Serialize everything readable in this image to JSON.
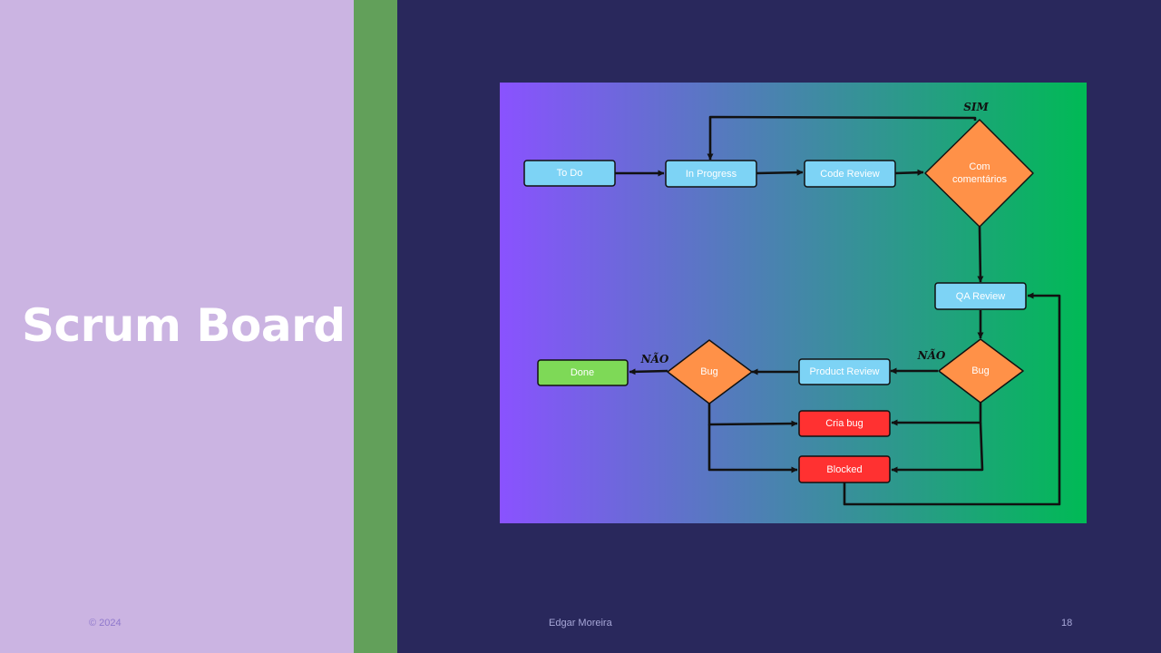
{
  "slide": {
    "title": "Scrum Board",
    "footer": {
      "date": "© 2024",
      "author": "Edgar Moreira",
      "page": "18"
    }
  },
  "diagram": {
    "nodes": {
      "todo": "To Do",
      "in_progress": "In Progress",
      "code_review": "Code Review",
      "com_comentarios_line1": "Com",
      "com_comentarios_line2": "comentários",
      "qa_review": "QA Review",
      "bug_qa": "Bug",
      "product_review": "Product Review",
      "bug_product": "Bug",
      "done": "Done",
      "cria_bug": "Cria bug",
      "blocked": "Blocked"
    },
    "edge_labels": {
      "sim": "SIM",
      "nao_qa": "NÃO",
      "nao_product": "NÃO"
    },
    "colors": {
      "gradient_start": "#8a52ff",
      "gradient_end": "#00ba55",
      "status_box": "#7dd3f5",
      "decision": "#ff9148",
      "done_box": "#7ed957",
      "alert_box": "#ff3131"
    }
  }
}
